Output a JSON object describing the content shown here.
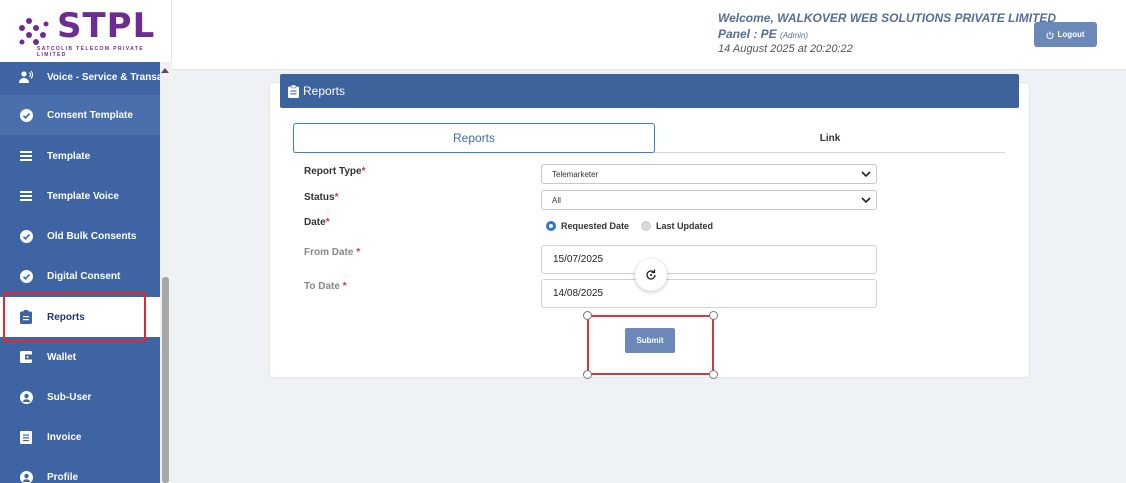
{
  "brand": {
    "name": "STPL",
    "tagline": "SATCOLIB TELECOM PRIVATE LIMITED",
    "color": "#6d2c91"
  },
  "header": {
    "welcome_prefix": "Welcome,",
    "company": "WALKOVER WEB SOLUTIONS PRIVATE LIMITED",
    "panel_label": "Panel : PE",
    "panel_role": "(Admin)",
    "datetime": "14 August 2025 at 20:20:22",
    "logout_label": "Logout"
  },
  "sidebar": {
    "items": [
      {
        "label": "Voice - Service & Transac",
        "icon": "voice-icon"
      },
      {
        "label": "Consent Template",
        "icon": "check-circle-icon"
      },
      {
        "label": "Template",
        "icon": "list-icon"
      },
      {
        "label": "Template Voice",
        "icon": "list-icon"
      },
      {
        "label": "Old Bulk Consents",
        "icon": "check-circle-icon"
      },
      {
        "label": "Digital Consent",
        "icon": "check-circle-icon"
      },
      {
        "label": "Reports",
        "icon": "clipboard-icon"
      },
      {
        "label": "Wallet",
        "icon": "wallet-icon"
      },
      {
        "label": "Sub-User",
        "icon": "user-circle-icon"
      },
      {
        "label": "Invoice",
        "icon": "invoice-icon"
      },
      {
        "label": "Profile",
        "icon": "user-circle-icon"
      }
    ]
  },
  "card": {
    "title": "Reports",
    "tabs": [
      {
        "label": "Reports"
      },
      {
        "label": "Link"
      }
    ]
  },
  "form": {
    "report_type_label": "Report Type",
    "report_type_value": "Telemarketer",
    "status_label": "Status",
    "status_value": "All",
    "date_label": "Date",
    "radio_requested": "Requested Date",
    "radio_updated": "Last Updated",
    "from_label": "From Date",
    "from_value": "15/07/2025",
    "to_label": "To Date",
    "to_value": "14/08/2025",
    "required_mark": "*",
    "submit_label": "Submit"
  }
}
